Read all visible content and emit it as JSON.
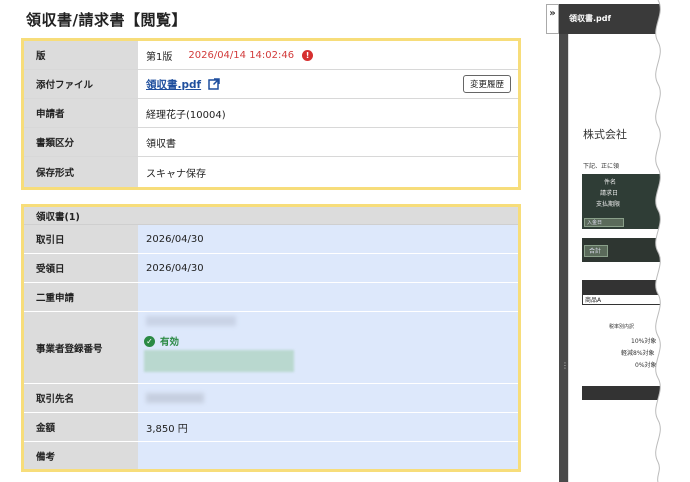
{
  "page": {
    "title": "領収書/請求書【閲覧】"
  },
  "doc_info": {
    "version_label": "版",
    "version_value": "第1版",
    "version_timestamp": "2026/04/14 14:02:46",
    "version_alert": "!",
    "attachment_label": "添付ファイル",
    "attachment_file": "領収書.pdf",
    "history_button": "変更履歴",
    "applicant_label": "申請者",
    "applicant_value": "経理花子(10004)",
    "category_label": "書類区分",
    "category_value": "領収書",
    "storage_label": "保存形式",
    "storage_value": "スキャナ保存"
  },
  "receipt": {
    "header": "領収書(1)",
    "transaction_date_label": "取引日",
    "transaction_date_value": "2026/04/30",
    "received_date_label": "受領日",
    "received_date_value": "2026/04/30",
    "duplicate_label": "二重申請",
    "registration_label": "事業者登録番号",
    "registration_status": "有効",
    "vendor_label": "取引先名",
    "amount_label": "金額",
    "amount_value": "3,850 円",
    "notes_label": "備考"
  },
  "viewer": {
    "collapse_label": "»",
    "file_name": "領収書.pdf",
    "doc_company": "株式会社",
    "doc_line1": "下記、正に領",
    "doc_field_subject": "件名",
    "doc_field_invoice_date": "請求日",
    "doc_field_due": "支払期限",
    "doc_field_payment": "入金日",
    "doc_total": "合計",
    "doc_item": "商品A",
    "doc_tax_breakdown": "税率別内訳",
    "doc_tax_10": "10%対象",
    "doc_tax_8": "軽減8%対象",
    "doc_tax_0": "0%対象"
  },
  "colors": {
    "panel_border": "#f7dd7a",
    "label_bg": "#dcdcdc",
    "receipt_bg": "#dde8fb",
    "timestamp_red": "#d23b3b",
    "valid_green": "#2b8a44",
    "link_blue": "#1f4f9e"
  }
}
